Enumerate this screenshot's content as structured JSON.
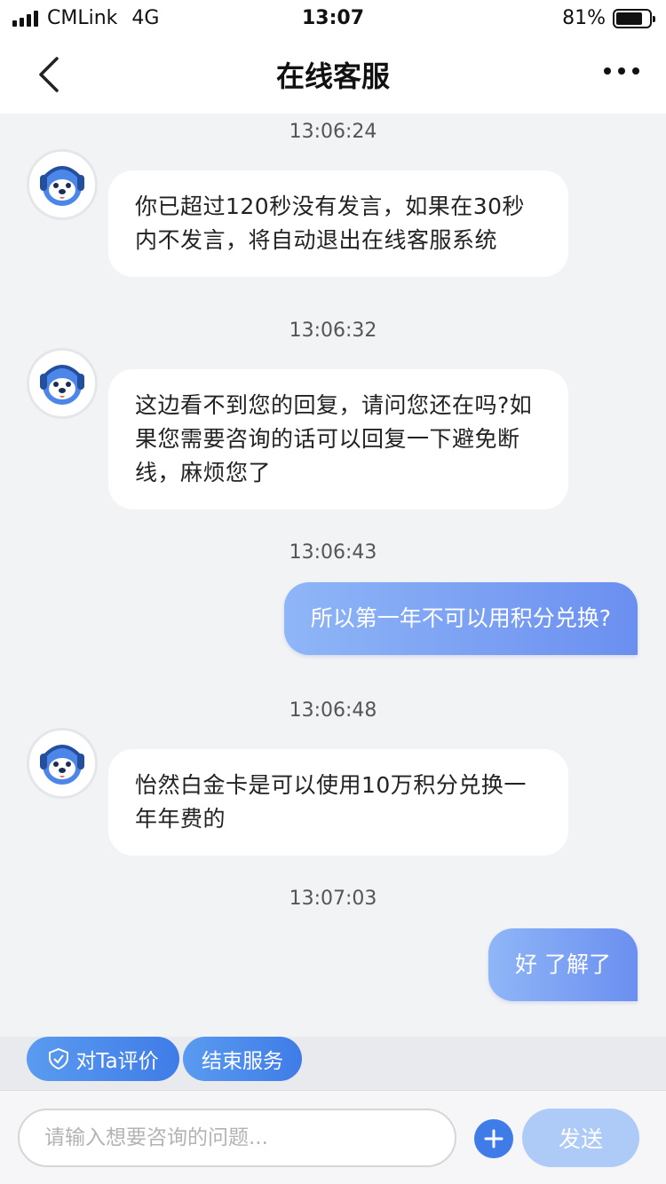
{
  "status_bar": {
    "carrier": "CMLink",
    "network": "4G",
    "time": "13:07",
    "battery_percent_text": "81%",
    "battery_level": 0.81
  },
  "nav": {
    "title": "在线客服",
    "back_icon": "chevron-left-icon",
    "more_icon": "more-horizontal-icon"
  },
  "messages": [
    {
      "time": "13:06:24",
      "side": "agent",
      "text": "你已超过120秒没有发言，如果在30秒内不发言，将自动退出在线客服系统"
    },
    {
      "time": "13:06:32",
      "side": "agent",
      "text": "这边看不到您的回复，请问您还在吗?如果您需要咨询的话可以回复一下避免断线，麻烦您了"
    },
    {
      "time": "13:06:43",
      "side": "user",
      "text": "所以第一年不可以用积分兑换?"
    },
    {
      "time": "13:06:48",
      "side": "agent",
      "text": "怡然白金卡是可以使用10万积分兑换一年年费的"
    },
    {
      "time": "13:07:03",
      "side": "user",
      "text": "好 了解了"
    }
  ],
  "quick_actions": {
    "rate_label": "对Ta评价",
    "rate_icon": "shield-icon",
    "end_label": "结束服务"
  },
  "composer": {
    "placeholder": "请输入想要咨询的问题...",
    "value": "",
    "plus_icon": "plus-icon",
    "send_label": "发送"
  },
  "colors": {
    "user_bubble_start": "#8fb6f7",
    "user_bubble_end": "#6b8ff0",
    "accent": "#3f7ce8",
    "send_disabled": "#aecaf6",
    "background": "#f2f3f5"
  }
}
